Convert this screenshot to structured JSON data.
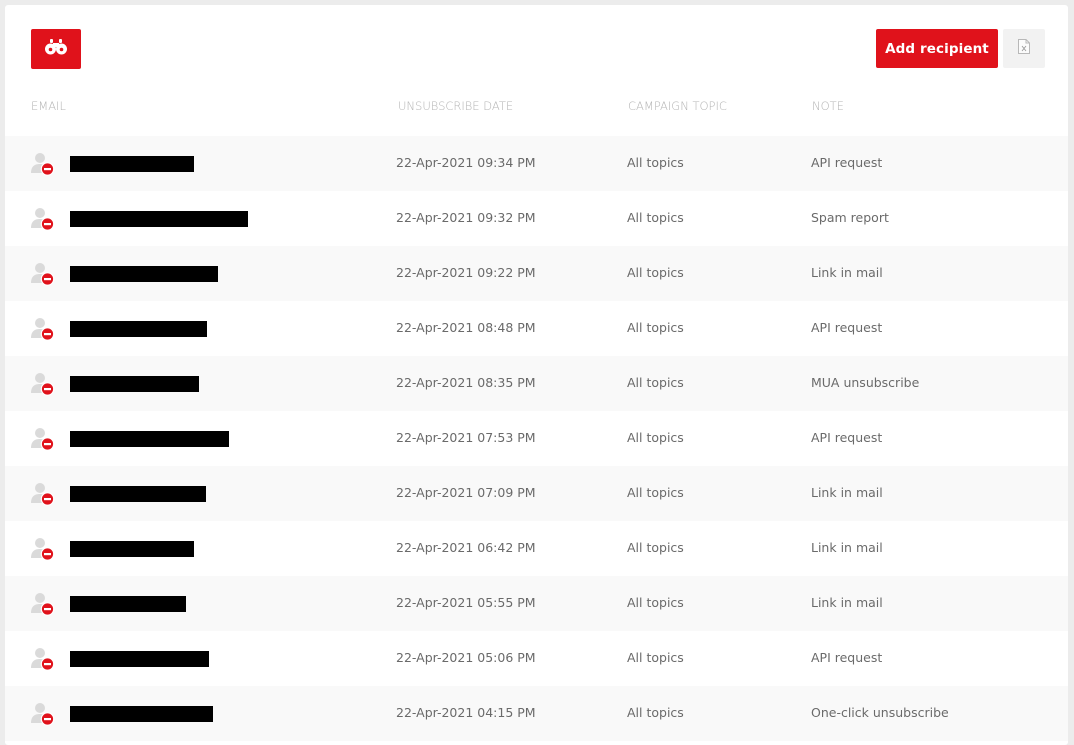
{
  "toolbar": {
    "search_icon": "binoculars-icon",
    "add_recipient_label": "Add recipient",
    "export_icon": "excel-file-icon"
  },
  "colors": {
    "accent": "#e0121b",
    "header_text": "#b3b3b3",
    "cell_text": "#6a6a6a",
    "row_alt": "#f9f9f9"
  },
  "table": {
    "columns": [
      "Email",
      "Unsubscribe date",
      "Campaign topic",
      "Note"
    ],
    "rows": [
      {
        "email": "[redacted]",
        "date": "22-Apr-2021 09:34 PM",
        "topic": "All topics",
        "note": "API request"
      },
      {
        "email": "[redacted]",
        "date": "22-Apr-2021 09:32 PM",
        "topic": "All topics",
        "note": "Spam report"
      },
      {
        "email": "[redacted]",
        "date": "22-Apr-2021 09:22 PM",
        "topic": "All topics",
        "note": "Link in mail"
      },
      {
        "email": "[redacted]",
        "date": "22-Apr-2021 08:48 PM",
        "topic": "All topics",
        "note": "API request"
      },
      {
        "email": "[redacted]",
        "date": "22-Apr-2021 08:35 PM",
        "topic": "All topics",
        "note": "MUA unsubscribe"
      },
      {
        "email": "[redacted]",
        "date": "22-Apr-2021 07:53 PM",
        "topic": "All topics",
        "note": "API request"
      },
      {
        "email": "[redacted]",
        "date": "22-Apr-2021 07:09 PM",
        "topic": "All topics",
        "note": "Link in mail"
      },
      {
        "email": "[redacted]",
        "date": "22-Apr-2021 06:42 PM",
        "topic": "All topics",
        "note": "Link in mail"
      },
      {
        "email": "[redacted]",
        "date": "22-Apr-2021 05:55 PM",
        "topic": "All topics",
        "note": "Link in mail"
      },
      {
        "email": "[redacted]",
        "date": "22-Apr-2021 05:06 PM",
        "topic": "All topics",
        "note": "API request"
      },
      {
        "email": "[redacted]",
        "date": "22-Apr-2021 04:15 PM",
        "topic": "All topics",
        "note": "One-click unsubscribe"
      }
    ]
  }
}
